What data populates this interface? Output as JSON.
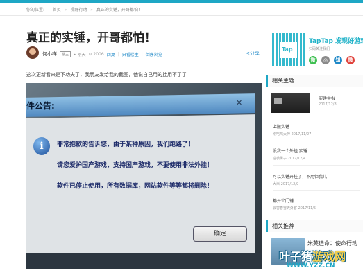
{
  "breadcrumb": {
    "prefix": "你的位置:",
    "items": [
      "首页",
      "视野行动",
      "真正的实锤，开哥都怕！"
    ]
  },
  "article": {
    "title": "真正的实锤，开哥都怕！",
    "author": "何小样",
    "badge": "楼主",
    "time": "• 刚天",
    "views": "⊙ 2006",
    "reply": "回复",
    "only_author": "只看楼主",
    "reverse": "倒序浏览",
    "share": "分享",
    "intro": "这次更新看来是下功夫了，我朋友发给我的截图，他说自己用的挂用不了了"
  },
  "dialog": {
    "title": "件公告:",
    "close": "✕",
    "line1": "非常抱歉的告诉您，由于某种原因，我们跑路了！",
    "line2": "请您爱护国产游戏，支持国产游戏，不要使用非法外挂！",
    "line3": "软件已停止使用，所有数据库，网站软件等等都将删除！",
    "ok": "确定"
  },
  "sidebar": {
    "tap_title": "TapTap 发现好游戏",
    "tap_sub": "扫码关注我们",
    "social": [
      {
        "label": "微",
        "color": "#3dbf50"
      },
      {
        "label": "◎",
        "color": "#8a8a8a"
      },
      {
        "label": "知",
        "color": "#1e88c7"
      },
      {
        "label": "微",
        "color": "#e0413a"
      }
    ],
    "related_heading": "相关主题",
    "hot_title": "实锤举报",
    "hot_date": "2017/12/8",
    "related": [
      {
        "title": "上限实锤",
        "meta": "刚吃鸡大神  2017/11/27"
      },
      {
        "title": "没我一个外挂 实锤",
        "meta": "逆袭男子  2017/12/4"
      },
      {
        "title": "可以实锤开挂了，不用但我儿",
        "meta": "大米  2017/12/9"
      },
      {
        "title": "都开个门锤",
        "meta": "云容春雪天外客  2017/11/5"
      }
    ],
    "rec_heading": "相关推荐",
    "rec_title": "米芙迪命：使命行动"
  },
  "watermark": {
    "brand": "叶子猪",
    "suffix": "游戏网",
    "url": "WWW.YZZ.CN"
  }
}
